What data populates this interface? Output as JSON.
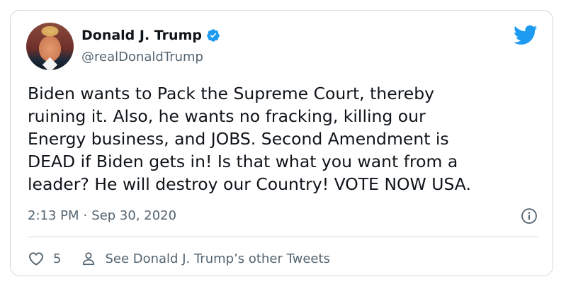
{
  "tweet": {
    "author": {
      "name": "Donald J. Trump",
      "handle": "@realDonaldTrump",
      "verified_icon": "verified-badge-icon",
      "avatar": "profile-photo"
    },
    "text": "Biden wants to Pack the Supreme Court, thereby\nruining it. Also, he wants no fracking, killing our\nEnergy business, and JOBS. Second Amendment is\nDEAD if Biden gets in! Is that what you want from a\nleader? He will destroy our Country! VOTE NOW USA.",
    "time": "2:13 PM",
    "separator": "·",
    "date": "Sep 30, 2020",
    "likes": "5",
    "other_tweets_label": "See Donald J. Trump’s other Tweets"
  },
  "colors": {
    "brand": "#1d9bf0",
    "text": "#0f1419",
    "muted": "#536471",
    "border": "#cfd9de"
  },
  "icons": {
    "brand": "twitter-bird-icon",
    "info": "info-icon",
    "like": "heart-icon",
    "profile": "person-icon"
  }
}
